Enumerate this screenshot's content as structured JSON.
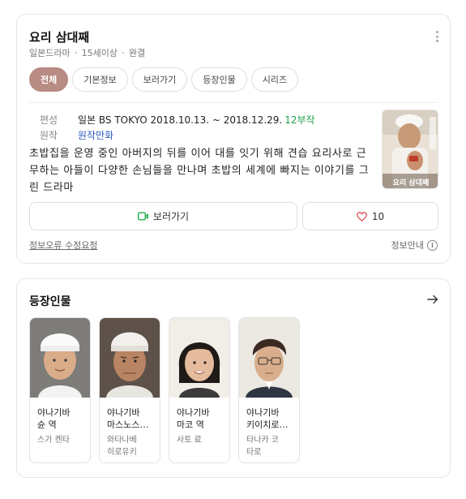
{
  "info": {
    "title": "요리 삼대째",
    "meta": [
      "일본드라마",
      "15세이상",
      "완결"
    ],
    "tabs": [
      {
        "label": "전체",
        "active": true
      },
      {
        "label": "기본정보",
        "active": false
      },
      {
        "label": "보러가기",
        "active": false
      },
      {
        "label": "등장인물",
        "active": false
      },
      {
        "label": "시리즈",
        "active": false
      }
    ],
    "broadcast_label": "편성",
    "broadcast_value": "일본 BS TOKYO  2018.10.13. ~ 2018.12.29.",
    "episodes": "12부작",
    "original_label": "원작",
    "original_value": "원작만화",
    "description": "초밥집을 운영 중인 아버지의 뒤를 이어 대를 잇기 위해 견습 요리사로 근무하는 아들이 다양한 손님들을 만나며 초밥의 세계에 빠지는 이야기를 그린 드라마",
    "poster_text": "요리 삼대째",
    "watch_button": "보러가기",
    "like_count": "10",
    "report_link": "정보오류 수정요청",
    "info_link": "정보안내"
  },
  "cast": {
    "title": "등장인물",
    "members": [
      {
        "name": "야나기바\n슌 역",
        "actor": "스가 켄타"
      },
      {
        "name": "야나기바\n마스노스…",
        "actor": "와타나베\n히로유키"
      },
      {
        "name": "야나기바\n마코 역",
        "actor": "사토 료"
      },
      {
        "name": "야나기바\n키이치로…",
        "actor": "타나카 코\n타로"
      }
    ]
  },
  "colors": {
    "active_tab": "#b88b83",
    "episodes_green": "#1f9e4a",
    "link_blue": "#2b59c3",
    "watch_icon_green": "#1fae4b",
    "heart_red": "#e0454f"
  }
}
